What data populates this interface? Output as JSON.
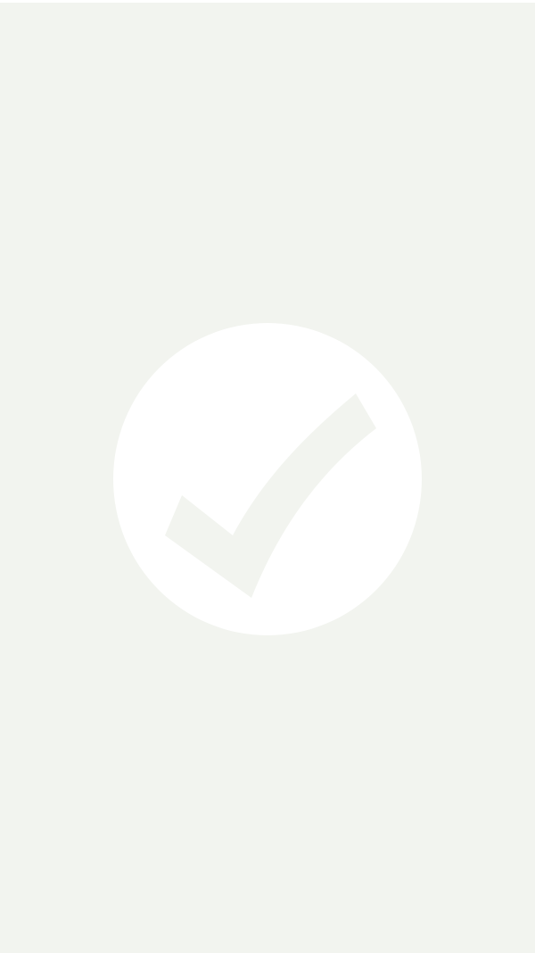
{
  "screen": {
    "background_color": "#f2f4ef",
    "badge_color": "#ffffff",
    "check_color": "#f2f4ef"
  },
  "icons": {
    "confirmation": "check-circle-icon"
  }
}
